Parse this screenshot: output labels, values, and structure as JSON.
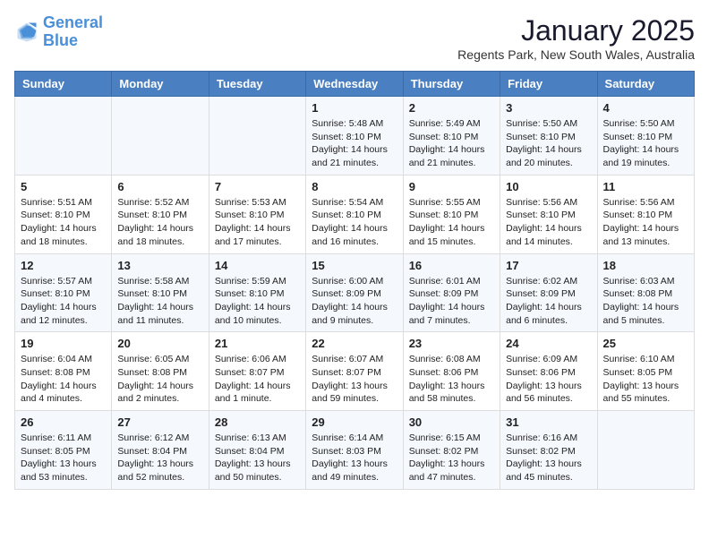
{
  "logo": {
    "text_general": "General",
    "text_blue": "Blue"
  },
  "header": {
    "title": "January 2025",
    "subtitle": "Regents Park, New South Wales, Australia"
  },
  "weekdays": [
    "Sunday",
    "Monday",
    "Tuesday",
    "Wednesday",
    "Thursday",
    "Friday",
    "Saturday"
  ],
  "weeks": [
    [
      {
        "day": "",
        "content": ""
      },
      {
        "day": "",
        "content": ""
      },
      {
        "day": "",
        "content": ""
      },
      {
        "day": "1",
        "content": "Sunrise: 5:48 AM\nSunset: 8:10 PM\nDaylight: 14 hours and 21 minutes."
      },
      {
        "day": "2",
        "content": "Sunrise: 5:49 AM\nSunset: 8:10 PM\nDaylight: 14 hours and 21 minutes."
      },
      {
        "day": "3",
        "content": "Sunrise: 5:50 AM\nSunset: 8:10 PM\nDaylight: 14 hours and 20 minutes."
      },
      {
        "day": "4",
        "content": "Sunrise: 5:50 AM\nSunset: 8:10 PM\nDaylight: 14 hours and 19 minutes."
      }
    ],
    [
      {
        "day": "5",
        "content": "Sunrise: 5:51 AM\nSunset: 8:10 PM\nDaylight: 14 hours and 18 minutes."
      },
      {
        "day": "6",
        "content": "Sunrise: 5:52 AM\nSunset: 8:10 PM\nDaylight: 14 hours and 18 minutes."
      },
      {
        "day": "7",
        "content": "Sunrise: 5:53 AM\nSunset: 8:10 PM\nDaylight: 14 hours and 17 minutes."
      },
      {
        "day": "8",
        "content": "Sunrise: 5:54 AM\nSunset: 8:10 PM\nDaylight: 14 hours and 16 minutes."
      },
      {
        "day": "9",
        "content": "Sunrise: 5:55 AM\nSunset: 8:10 PM\nDaylight: 14 hours and 15 minutes."
      },
      {
        "day": "10",
        "content": "Sunrise: 5:56 AM\nSunset: 8:10 PM\nDaylight: 14 hours and 14 minutes."
      },
      {
        "day": "11",
        "content": "Sunrise: 5:56 AM\nSunset: 8:10 PM\nDaylight: 14 hours and 13 minutes."
      }
    ],
    [
      {
        "day": "12",
        "content": "Sunrise: 5:57 AM\nSunset: 8:10 PM\nDaylight: 14 hours and 12 minutes."
      },
      {
        "day": "13",
        "content": "Sunrise: 5:58 AM\nSunset: 8:10 PM\nDaylight: 14 hours and 11 minutes."
      },
      {
        "day": "14",
        "content": "Sunrise: 5:59 AM\nSunset: 8:10 PM\nDaylight: 14 hours and 10 minutes."
      },
      {
        "day": "15",
        "content": "Sunrise: 6:00 AM\nSunset: 8:09 PM\nDaylight: 14 hours and 9 minutes."
      },
      {
        "day": "16",
        "content": "Sunrise: 6:01 AM\nSunset: 8:09 PM\nDaylight: 14 hours and 7 minutes."
      },
      {
        "day": "17",
        "content": "Sunrise: 6:02 AM\nSunset: 8:09 PM\nDaylight: 14 hours and 6 minutes."
      },
      {
        "day": "18",
        "content": "Sunrise: 6:03 AM\nSunset: 8:08 PM\nDaylight: 14 hours and 5 minutes."
      }
    ],
    [
      {
        "day": "19",
        "content": "Sunrise: 6:04 AM\nSunset: 8:08 PM\nDaylight: 14 hours and 4 minutes."
      },
      {
        "day": "20",
        "content": "Sunrise: 6:05 AM\nSunset: 8:08 PM\nDaylight: 14 hours and 2 minutes."
      },
      {
        "day": "21",
        "content": "Sunrise: 6:06 AM\nSunset: 8:07 PM\nDaylight: 14 hours and 1 minute."
      },
      {
        "day": "22",
        "content": "Sunrise: 6:07 AM\nSunset: 8:07 PM\nDaylight: 13 hours and 59 minutes."
      },
      {
        "day": "23",
        "content": "Sunrise: 6:08 AM\nSunset: 8:06 PM\nDaylight: 13 hours and 58 minutes."
      },
      {
        "day": "24",
        "content": "Sunrise: 6:09 AM\nSunset: 8:06 PM\nDaylight: 13 hours and 56 minutes."
      },
      {
        "day": "25",
        "content": "Sunrise: 6:10 AM\nSunset: 8:05 PM\nDaylight: 13 hours and 55 minutes."
      }
    ],
    [
      {
        "day": "26",
        "content": "Sunrise: 6:11 AM\nSunset: 8:05 PM\nDaylight: 13 hours and 53 minutes."
      },
      {
        "day": "27",
        "content": "Sunrise: 6:12 AM\nSunset: 8:04 PM\nDaylight: 13 hours and 52 minutes."
      },
      {
        "day": "28",
        "content": "Sunrise: 6:13 AM\nSunset: 8:04 PM\nDaylight: 13 hours and 50 minutes."
      },
      {
        "day": "29",
        "content": "Sunrise: 6:14 AM\nSunset: 8:03 PM\nDaylight: 13 hours and 49 minutes."
      },
      {
        "day": "30",
        "content": "Sunrise: 6:15 AM\nSunset: 8:02 PM\nDaylight: 13 hours and 47 minutes."
      },
      {
        "day": "31",
        "content": "Sunrise: 6:16 AM\nSunset: 8:02 PM\nDaylight: 13 hours and 45 minutes."
      },
      {
        "day": "",
        "content": ""
      }
    ]
  ]
}
